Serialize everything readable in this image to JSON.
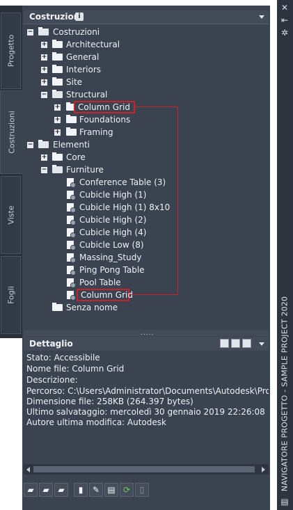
{
  "side_tabs": [
    "Progetto",
    "Costruzioni",
    "Viste",
    "Fogli"
  ],
  "palette_title": "NAVIGATORE PROGETTO - SAMPLE PROJECT 2020",
  "tree_panel": {
    "title": "Costruzioni",
    "info_badge": "i"
  },
  "tree": {
    "costruzioni": "Costruzioni",
    "architectural": "Architectural",
    "general": "General",
    "interiors": "Interiors",
    "site": "Site",
    "structural": "Structural",
    "column_grid": "Column Grid",
    "foundations": "Foundations",
    "framing": "Framing",
    "elementi": "Elementi",
    "core": "Core",
    "furniture": "Furniture",
    "items": [
      "Conference Table (3)",
      "Cubicle High (1)",
      "Cubicle High (1) 8x10",
      "Cubicle High (2)",
      "Cubicle High (4)",
      "Cubicle Low (8)",
      "Massing_Study",
      "Ping Pong Table",
      "Pool Table",
      "Column Grid"
    ],
    "senza_nome": "Senza nome"
  },
  "splitter_grip": ".....",
  "detail_panel": {
    "title": "Dettaglio",
    "lines": [
      "Stato: Accessibile",
      "Nome file: Column Grid",
      "Descrizione:",
      "Percorso: C:\\Users\\Administrator\\Documents\\Autodesk\\Progetti\\S",
      "Dimensione file: 258KB (264.397 bytes)",
      "Ultimo salvataggio: mercoledì 30 gennaio 2019  22:26:08",
      "Autore ultima modifica: Autodesk"
    ]
  },
  "right_strip_icons": [
    "close-icon",
    "auto-hide-icon",
    "properties-icon",
    "palette-menu-icon"
  ],
  "highlight_color": "#c8222a"
}
